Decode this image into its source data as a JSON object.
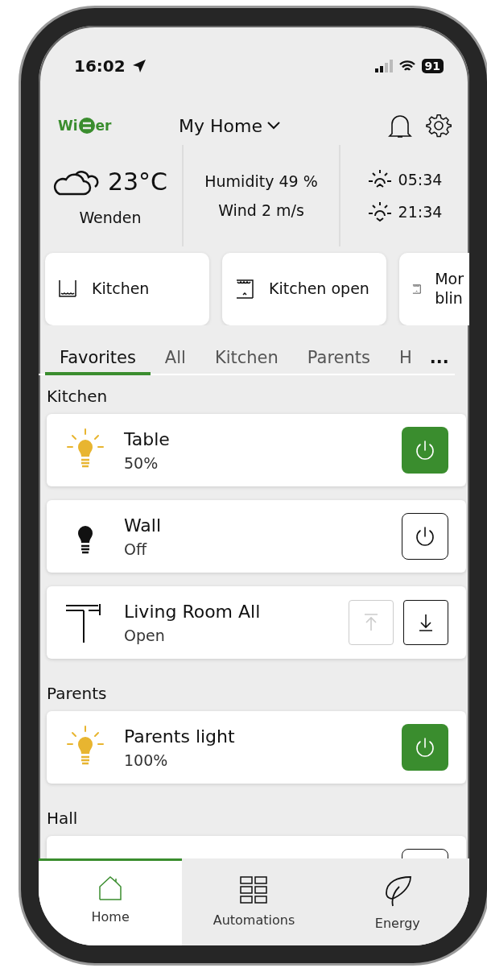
{
  "status_bar": {
    "time": "16:02",
    "battery": "91"
  },
  "header": {
    "logo": {
      "left": "Wi",
      "right": "er"
    },
    "home": "My Home"
  },
  "weather": {
    "temperature": "23°C",
    "city": "Wenden",
    "humidity": "Humidity 49 %",
    "wind": "Wind 2 m/s",
    "sunrise": "05:34",
    "sunset": "21:34"
  },
  "scenes": [
    {
      "label": "Kitchen",
      "kind": "closed"
    },
    {
      "label": "Kitchen open",
      "kind": "open"
    },
    {
      "label": "Mor blin",
      "kind": "open"
    }
  ],
  "tabs": [
    {
      "label": "Favorites",
      "selected": true
    },
    {
      "label": "All",
      "selected": false
    },
    {
      "label": "Kitchen",
      "selected": false
    },
    {
      "label": "Parents",
      "selected": false
    },
    {
      "label": "H",
      "selected": false
    }
  ],
  "more": "...",
  "sections": [
    {
      "title": "Kitchen",
      "devices": [
        {
          "kind": "light",
          "name": "Table",
          "status": "50%",
          "on": true
        },
        {
          "kind": "light",
          "name": "Wall",
          "status": "Off",
          "on": false
        },
        {
          "kind": "blind",
          "name": "Living Room All",
          "status": "Open",
          "up_disabled": true
        }
      ]
    },
    {
      "title": "Parents",
      "devices": [
        {
          "kind": "light",
          "name": "Parents light",
          "status": "100%",
          "on": true
        }
      ]
    },
    {
      "title": "Hall",
      "devices": [
        {
          "kind": "partial",
          "on": false
        }
      ]
    }
  ],
  "nav": [
    {
      "label": "Home",
      "kind": "home",
      "selected": true
    },
    {
      "label": "Automations",
      "kind": "grid",
      "selected": false
    },
    {
      "label": "Energy",
      "kind": "leaf",
      "selected": false
    }
  ]
}
